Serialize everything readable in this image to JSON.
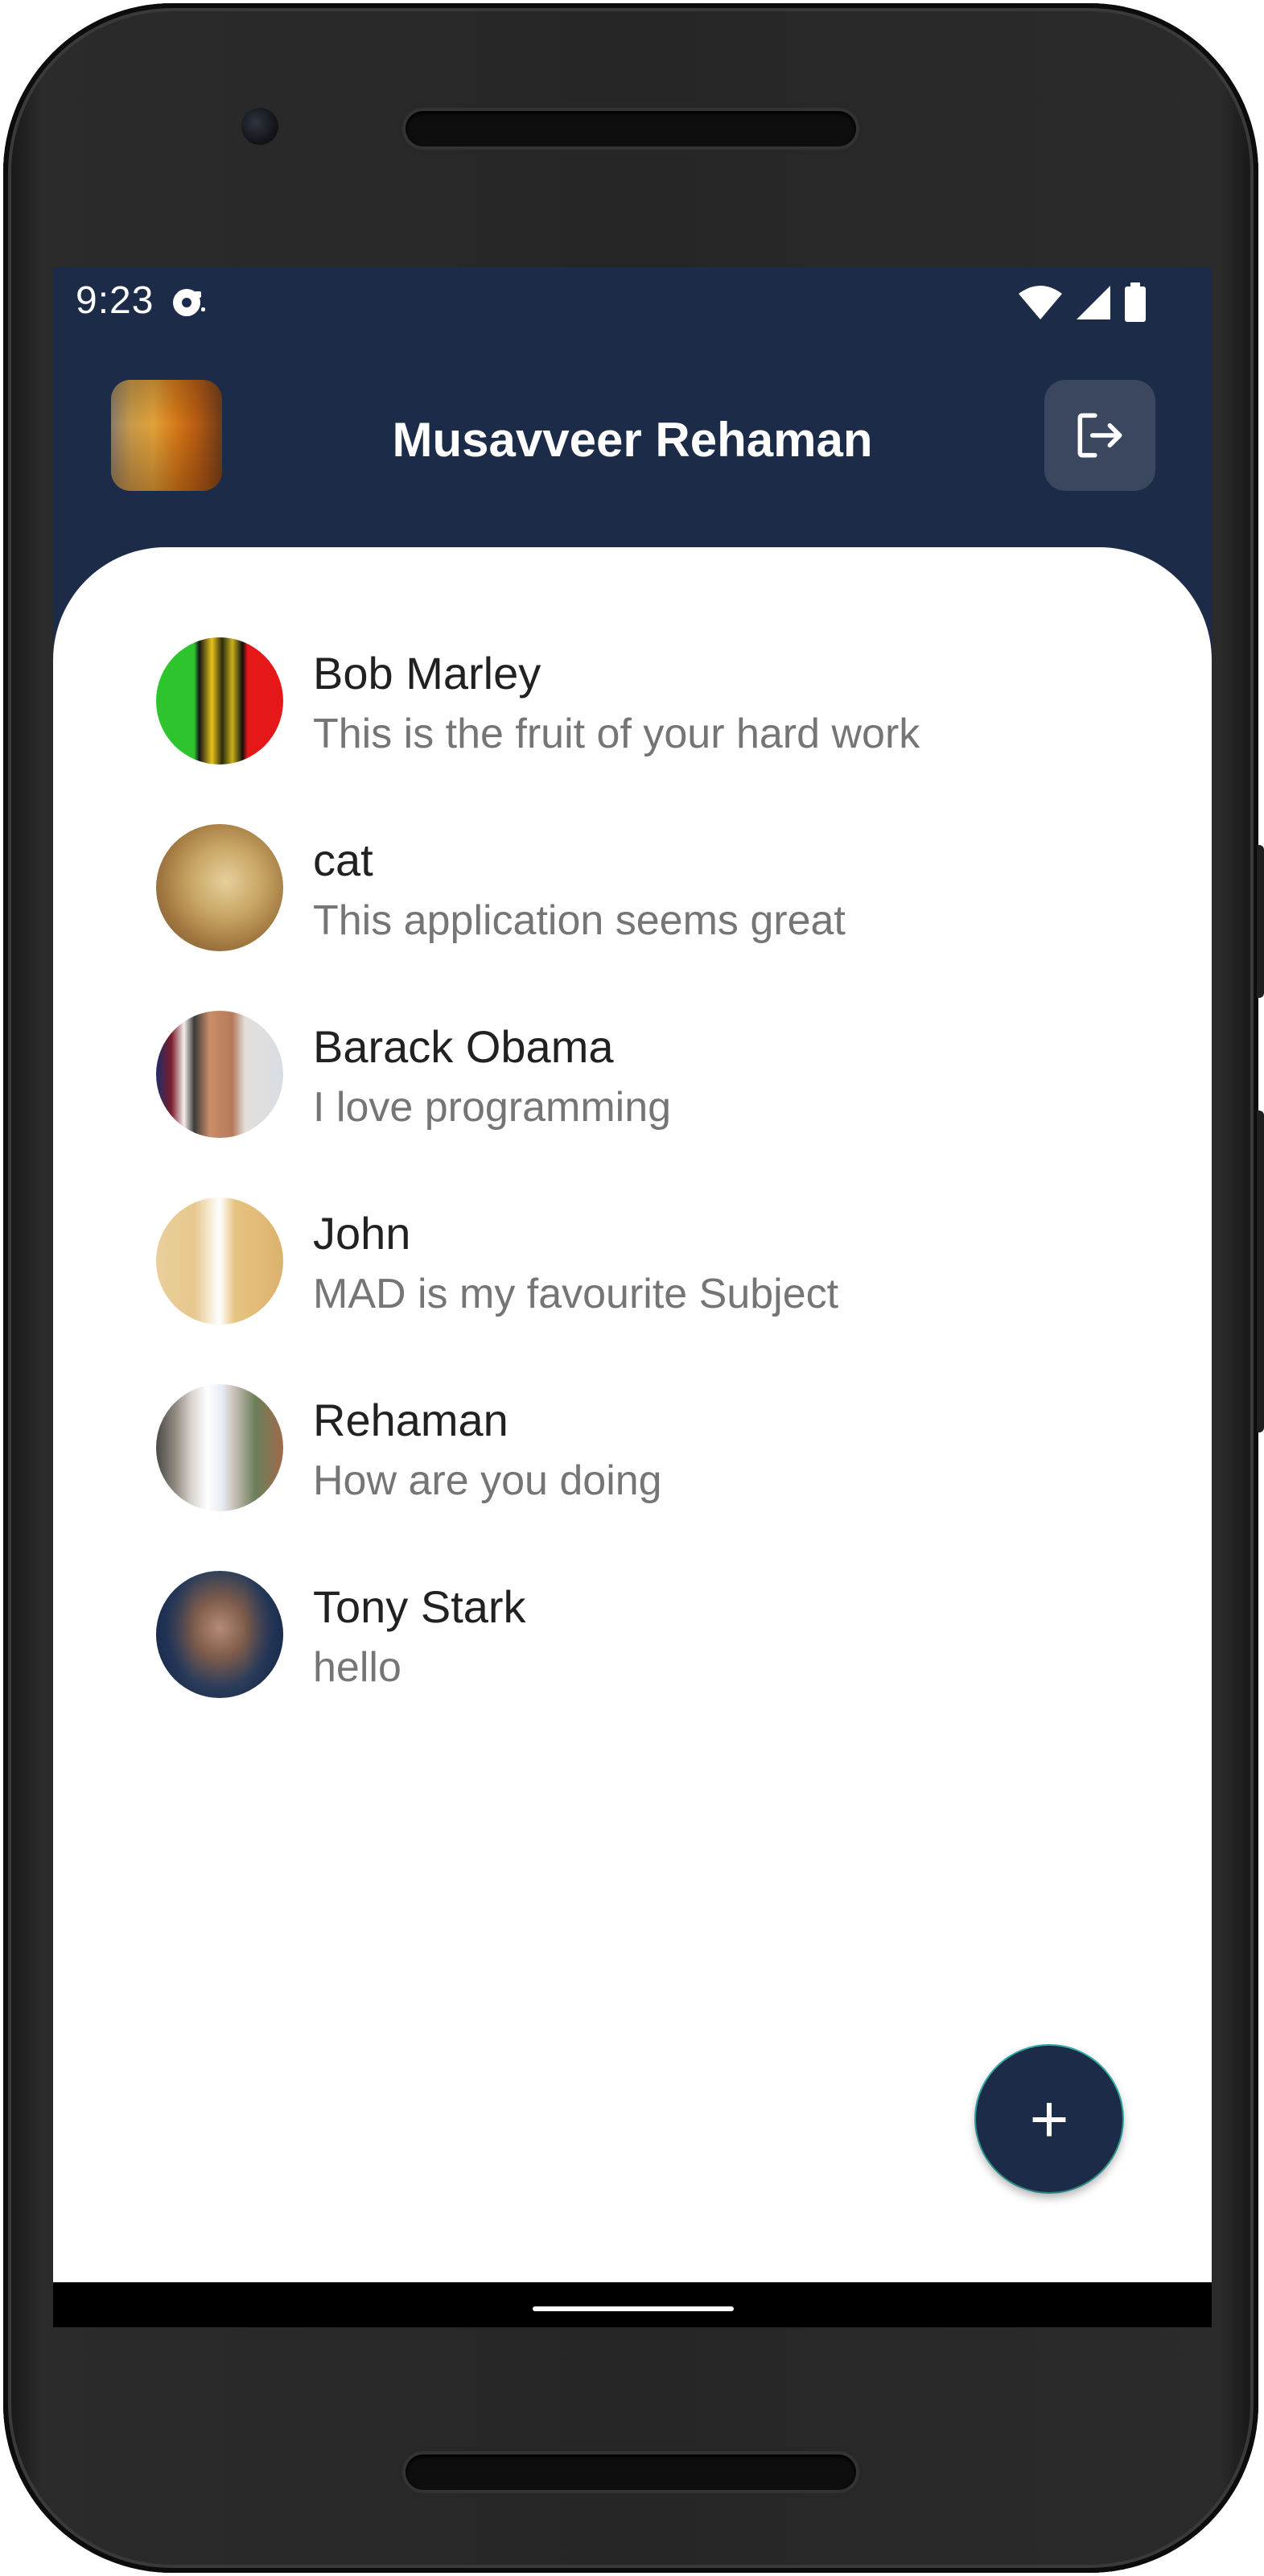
{
  "status_bar": {
    "time": "9:23",
    "icons": [
      "notification-icon",
      "wifi-icon",
      "signal-icon",
      "battery-icon"
    ]
  },
  "header": {
    "title": "Musavveer Rehaman",
    "logout_icon": "logout-icon"
  },
  "chats": [
    {
      "name": "Bob Marley",
      "message": "This is the fruit of your hard work"
    },
    {
      "name": "cat",
      "message": "This application seems great"
    },
    {
      "name": "Barack Obama",
      "message": "I love programming"
    },
    {
      "name": "John",
      "message": "MAD is my favourite Subject"
    },
    {
      "name": "Rehaman",
      "message": "How are you doing"
    },
    {
      "name": "Tony Stark",
      "message": "hello"
    }
  ],
  "fab": {
    "label": "+",
    "icon": "plus-icon"
  },
  "colors": {
    "primary": "#1c2b47",
    "surface": "#ffffff",
    "logout_bg": "#3a475f",
    "title_text": "#212121",
    "subtitle_text": "#757575"
  }
}
